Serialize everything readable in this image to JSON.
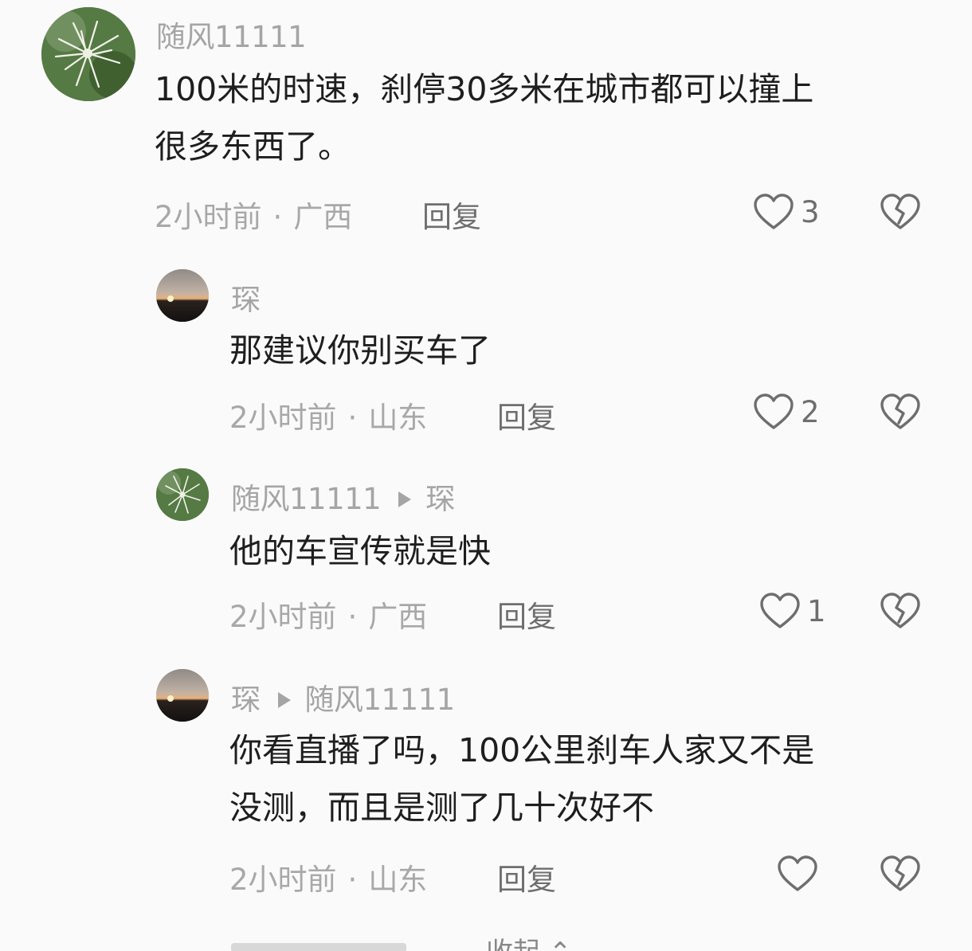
{
  "comments": [
    {
      "username": "随风11111",
      "reply_to": "",
      "content_lines": [
        "100米的时速，刹停30多米在城市都可以撞上",
        "很多东西了。"
      ],
      "time": "2小时前",
      "location": "广西",
      "reply_label": "回复",
      "likes": "3",
      "avatar_icon": "plant-avatar"
    },
    {
      "username": "琛",
      "reply_to": "",
      "content_lines": [
        "那建议你别买车了"
      ],
      "time": "2小时前",
      "location": "山东",
      "reply_label": "回复",
      "likes": "2",
      "avatar_icon": "sunset-avatar"
    },
    {
      "username": "随风11111",
      "reply_to": "琛",
      "content_lines": [
        "他的车宣传就是快"
      ],
      "time": "2小时前",
      "location": "广西",
      "reply_label": "回复",
      "likes": "1",
      "avatar_icon": "plant-avatar"
    },
    {
      "username": "琛",
      "reply_to": "随风11111",
      "content_lines": [
        "你看直播了吗，100公里刹车人家又不是",
        "没测，而且是测了几十次好不"
      ],
      "time": "2小时前",
      "location": "山东",
      "reply_label": "回复",
      "likes": "",
      "avatar_icon": "sunset-avatar"
    }
  ],
  "footer": {
    "collapse_label": "收起"
  },
  "icons": {
    "like": "heart-outline-icon",
    "dislike": "broken-heart-icon",
    "reply_arrow": "triangle-right-icon"
  },
  "colors": {
    "text": "#1e1e1e",
    "muted": "#a5a5a5",
    "background": "#fafafa"
  }
}
